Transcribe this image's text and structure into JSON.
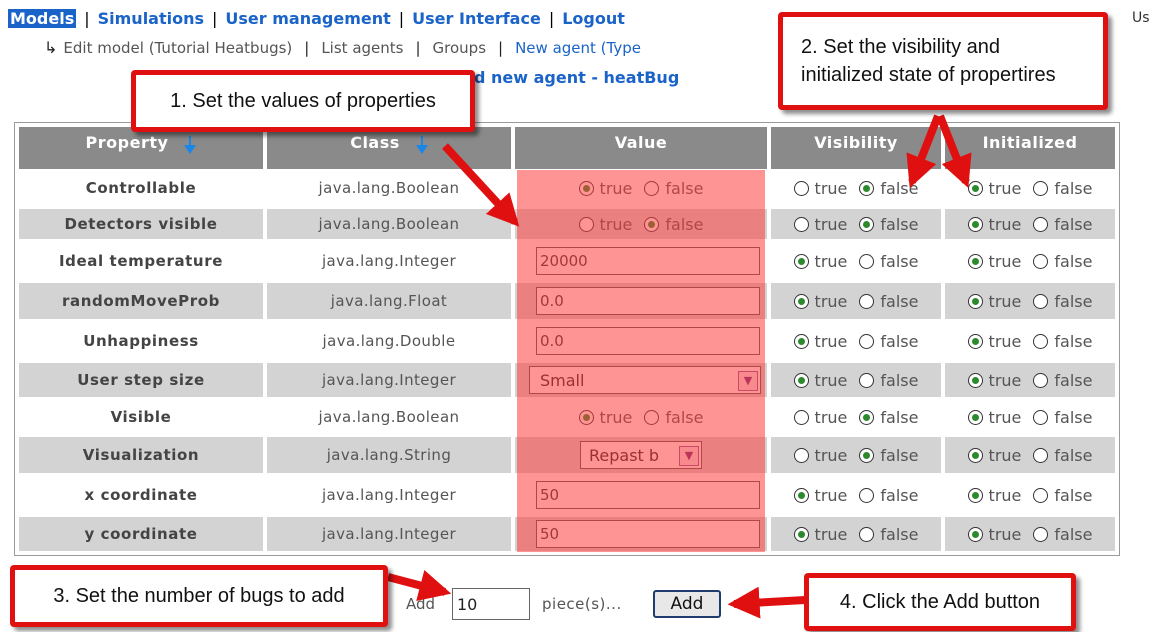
{
  "nav": {
    "items": [
      "Models",
      "Simulations",
      "User management",
      "User Interface",
      "Logout"
    ],
    "user_partial": "Us"
  },
  "subnav": {
    "items": [
      "Edit model (Tutorial Heatbugs)",
      "List agents",
      "Groups",
      "New agent (Type"
    ]
  },
  "page_title": "d new agent - heatBug",
  "table": {
    "headers": {
      "property": "Property",
      "class": "Class",
      "value": "Value",
      "visibility": "Visibility",
      "initialized": "Initialized"
    },
    "true_label": "true",
    "false_label": "false",
    "rows": [
      {
        "property": "Controllable",
        "class": "java.lang.Boolean",
        "value_type": "radio",
        "value": "true",
        "visibility": "false",
        "initialized": "true"
      },
      {
        "property": "Detectors visible",
        "class": "java.lang.Boolean",
        "value_type": "radio",
        "value": "false",
        "visibility": "false",
        "initialized": "true"
      },
      {
        "property": "Ideal temperature",
        "class": "java.lang.Integer",
        "value_type": "text",
        "value": "20000",
        "visibility": "true",
        "initialized": "true"
      },
      {
        "property": "randomMoveProb",
        "class": "java.lang.Float",
        "value_type": "text",
        "value": "0.0",
        "visibility": "true",
        "initialized": "true"
      },
      {
        "property": "Unhappiness",
        "class": "java.lang.Double",
        "value_type": "text",
        "value": "0.0",
        "visibility": "true",
        "initialized": "true"
      },
      {
        "property": "User step size",
        "class": "java.lang.Integer",
        "value_type": "select",
        "value": "Small",
        "visibility": "true",
        "initialized": "true"
      },
      {
        "property": "Visible",
        "class": "java.lang.Boolean",
        "value_type": "radio",
        "value": "true",
        "visibility": "false",
        "initialized": "true"
      },
      {
        "property": "Visualization",
        "class": "java.lang.String",
        "value_type": "select_small",
        "value": "Repast b",
        "visibility": "false",
        "initialized": "true"
      },
      {
        "property": "x coordinate",
        "class": "java.lang.Integer",
        "value_type": "text",
        "value": "50",
        "visibility": "true",
        "initialized": "true"
      },
      {
        "property": "y coordinate",
        "class": "java.lang.Integer",
        "value_type": "text",
        "value": "50",
        "visibility": "true",
        "initialized": "true"
      }
    ]
  },
  "add_form": {
    "add_label": "Add",
    "count_value": "10",
    "pieces_label": "piece(s)...",
    "button_label": "Add"
  },
  "callouts": {
    "c1": "1. Set the values of properties",
    "c2_line1": "2. Set the visibility and",
    "c2_line2": "initialized state of propertires",
    "c3": "3. Set the number of bugs to add",
    "c4": "4. Click the Add button"
  },
  "colors": {
    "link_blue": "#1a63c8",
    "header_gray": "#8a8a8a",
    "row_shade": "#d3d3d3",
    "callout_red": "#e01010",
    "overlay_red": "rgba(255,60,60,0.55)"
  }
}
